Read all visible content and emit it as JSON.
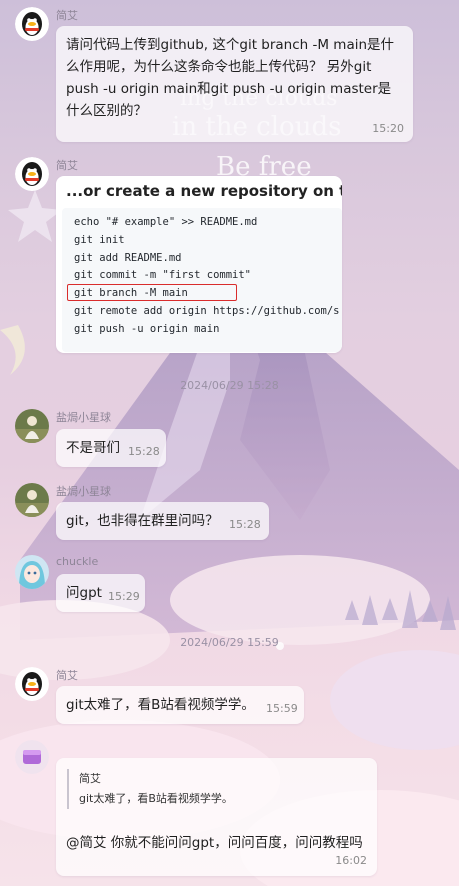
{
  "background": {
    "texts": [
      "ing the clouds",
      "in the clouds",
      "Be free"
    ]
  },
  "messages": [
    {
      "sender": "简艾",
      "text": "请问代码上传到github, 这个git branch -M main是什么作用呢，为什么这条命令也能上传代码？ 另外git push -u origin main和git push -u origin master是什么区别的？",
      "time": "15:20"
    },
    {
      "sender": "简艾",
      "image": {
        "title": "...or create a new repository on the command line",
        "code_lines": [
          "echo \"# example\" >> README.md",
          "git init",
          "git add README.md",
          "git commit -m \"first commit\"",
          "git branch -M main",
          "git remote add origin https://github.com/s",
          "git push -u origin main"
        ]
      }
    },
    {
      "separator": "2024/06/29 15:28"
    },
    {
      "sender": "盐焗小星球",
      "text": "不是哥们",
      "time": "15:28"
    },
    {
      "sender": "盐焗小星球",
      "text": "git，也非得在群里问吗？",
      "time": "15:28"
    },
    {
      "sender": "chuckle",
      "text": "问gpt",
      "time": "15:29"
    },
    {
      "separator": "2024/06/29 15:59"
    },
    {
      "sender": "简艾",
      "text": "git太难了，看B站看视频学学。",
      "time": "15:59"
    },
    {
      "sender": "",
      "quote": {
        "author": "简艾",
        "text": "git太难了，看B站看视频学学。"
      },
      "text": "@简艾 你就不能问问gpt，问问百度，问问教程吗",
      "time": "16:02"
    }
  ],
  "colors": {
    "bubble": "#ffffff",
    "highlight": "#d92c2c",
    "name": "#8e8597"
  }
}
